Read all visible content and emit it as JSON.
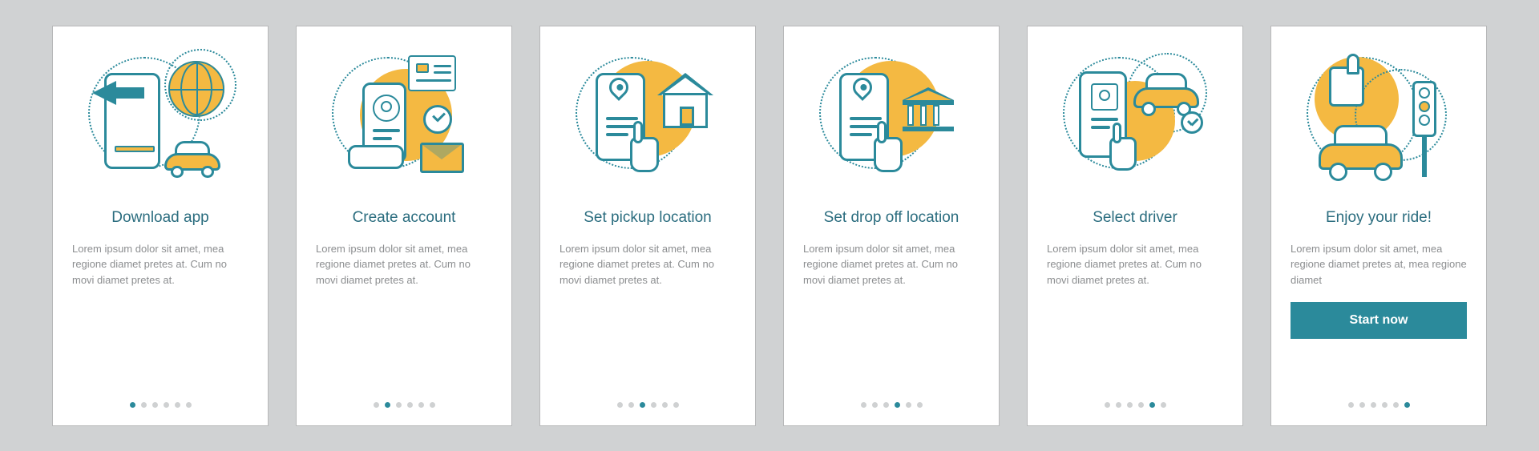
{
  "totalSteps": 6,
  "colors": {
    "accent": "#2b8a9b",
    "highlight": "#f4b942",
    "muted": "#8c8e90"
  },
  "screens": [
    {
      "title": "Download app",
      "description": "Lorem ipsum dolor sit amet, mea regione diamet pretes at. Cum no movi diamet pretes at.",
      "activeIndex": 0,
      "hasCTA": false,
      "illustration": "download-app"
    },
    {
      "title": "Create account",
      "description": "Lorem ipsum dolor sit amet, mea regione diamet pretes at. Cum no movi diamet pretes at.",
      "activeIndex": 1,
      "hasCTA": false,
      "illustration": "create-account"
    },
    {
      "title": "Set pickup location",
      "description": "Lorem ipsum dolor sit amet, mea regione diamet pretes at. Cum no movi diamet pretes at.",
      "activeIndex": 2,
      "hasCTA": false,
      "illustration": "pickup-location"
    },
    {
      "title": "Set drop off location",
      "description": "Lorem ipsum dolor sit amet, mea regione diamet pretes at. Cum no movi diamet pretes at.",
      "activeIndex": 3,
      "hasCTA": false,
      "illustration": "dropoff-location"
    },
    {
      "title": "Select driver",
      "description": "Lorem ipsum dolor sit amet, mea regione diamet pretes at. Cum no movi diamet pretes at.",
      "activeIndex": 4,
      "hasCTA": false,
      "illustration": "select-driver"
    },
    {
      "title": "Enjoy your ride!",
      "description": "Lorem ipsum dolor sit amet, mea regione diamet pretes at, mea regione diamet",
      "activeIndex": 5,
      "hasCTA": true,
      "ctaLabel": "Start now",
      "illustration": "enjoy-ride"
    }
  ]
}
